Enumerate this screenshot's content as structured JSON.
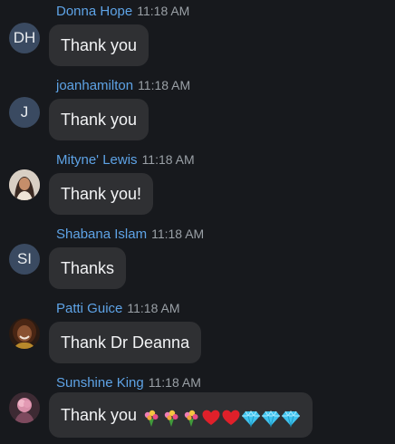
{
  "messages": [
    {
      "sender": "Donna Hope",
      "time": "11:18 AM",
      "text": "Thank you",
      "avatar": {
        "type": "initials",
        "initials": "DH"
      }
    },
    {
      "sender": "joanhamilton",
      "time": "11:18 AM",
      "text": "Thank you",
      "avatar": {
        "type": "initials",
        "initials": "J"
      }
    },
    {
      "sender": "Mityne' Lewis",
      "time": "11:18 AM",
      "text": "Thank you!",
      "avatar": {
        "type": "photo",
        "icon": "user-photo"
      }
    },
    {
      "sender": "Shabana Islam",
      "time": "11:18 AM",
      "text": "Thanks",
      "avatar": {
        "type": "initials",
        "initials": "SI"
      }
    },
    {
      "sender": "Patti Guice",
      "time": "11:18 AM",
      "text": "Thank Dr Deanna",
      "avatar": {
        "type": "photo",
        "icon": "user-photo"
      }
    },
    {
      "sender": "Sunshine King",
      "time": "11:18 AM",
      "text": "Thank you",
      "avatar": {
        "type": "photo",
        "icon": "user-photo"
      },
      "emojis": [
        "bouquet",
        "bouquet",
        "bouquet",
        "red-heart",
        "red-heart",
        "gem",
        "gem",
        "gem"
      ]
    }
  ],
  "colors": {
    "background": "#17191d",
    "bubble": "#2f3033",
    "sender_name": "#5ea3e6",
    "timestamp": "#9aa0a6",
    "initials_avatar": "#3a4a61"
  }
}
